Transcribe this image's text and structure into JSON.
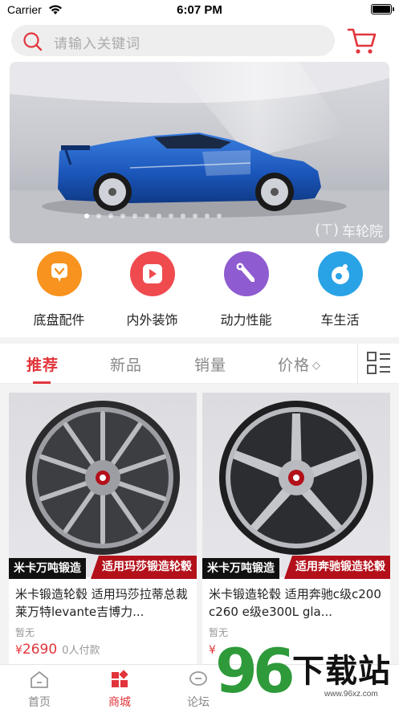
{
  "status_bar": {
    "carrier": "Carrier",
    "time": "6:07 PM"
  },
  "search": {
    "placeholder": "请输入关键词"
  },
  "banner": {
    "watermark": "车轮院",
    "slide_count": 12,
    "active_slide": 1
  },
  "categories": [
    {
      "label": "底盘配件",
      "icon": "chat-bubble-icon",
      "color": "#f7931e"
    },
    {
      "label": "内外装饰",
      "icon": "play-icon",
      "color": "#ef4b4f"
    },
    {
      "label": "动力性能",
      "icon": "wrench-icon",
      "color": "#8e5bd0"
    },
    {
      "label": "车生活",
      "icon": "lifestyle-icon",
      "color": "#2aa3e6"
    }
  ],
  "sort_tabs": {
    "recommend": "推荐",
    "new": "新品",
    "sales": "销量",
    "price": "价格",
    "active": "recommend"
  },
  "products": [
    {
      "tag_brand": "米卡万吨锻造",
      "tag_fit": "适用玛莎锻造轮毂",
      "title": "米卡锻造轮毂 适用玛莎拉蒂总裁莱万特levante吉博力...",
      "sub": "暂无",
      "price_symbol": "¥",
      "price": "2690",
      "sold": "0人付款"
    },
    {
      "tag_brand": "米卡万吨锻造",
      "tag_fit": "适用奔驰锻造轮毂",
      "title": "米卡锻造轮毂 适用奔驰c级c200 c260 e级e300L gla...",
      "sub": "暂无",
      "price_symbol": "¥",
      "price": "",
      "sold": ""
    }
  ],
  "tabbar": {
    "home": "首页",
    "mall": "商城",
    "forum": "论坛",
    "active": "mall"
  },
  "site_logo": {
    "number": "96",
    "text": "下载站",
    "url": "www.96xz.com"
  },
  "colors": {
    "accent": "#e2353b",
    "tag_red": "#b3101a",
    "logo_green": "#2e9a3a"
  }
}
